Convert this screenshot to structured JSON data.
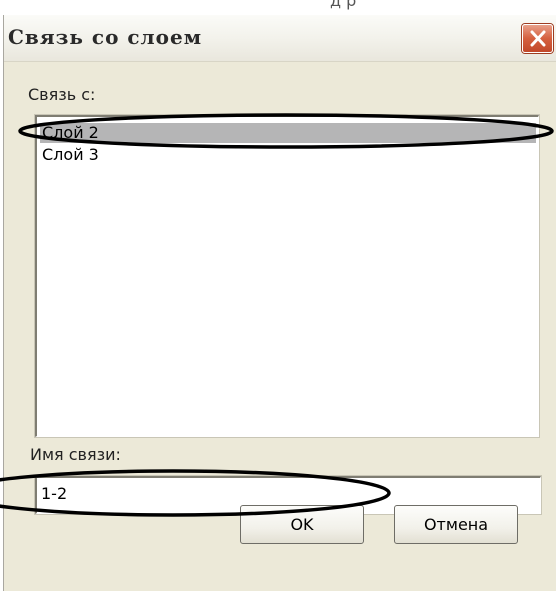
{
  "top_clip_text": "д    р",
  "dialog": {
    "title": "Связь со слоем",
    "close_icon": "close-icon",
    "link_with_label": "Связь с:",
    "layers": [
      {
        "label": "Слой 2",
        "selected": true
      },
      {
        "label": "Слой 3",
        "selected": false
      }
    ],
    "link_name_label": "Имя связи:",
    "link_name_value": "1-2",
    "ok_label": "OK",
    "cancel_label": "Отмена"
  },
  "colors": {
    "dialog_bg": "#ECE9D8",
    "close_button": "#D5603F",
    "selection": "#B5B5B6",
    "annotation": "#000000"
  }
}
